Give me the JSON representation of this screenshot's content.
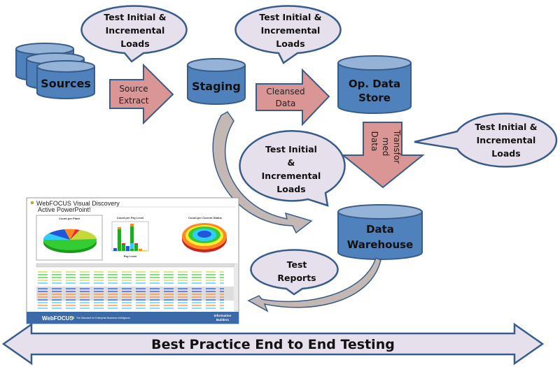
{
  "colors": {
    "cylinder": "#4f81bd",
    "cylinder_top": "#95b3d7",
    "stroke": "#385d8a",
    "arrow": "#d99694",
    "callout": "#e6e0ec",
    "curve": "#c4b8b4"
  },
  "nodes": {
    "sources": "Sources",
    "staging": "Staging",
    "ods": [
      "Op. Data",
      "Store"
    ],
    "dw": [
      "Data",
      "Warehouse"
    ]
  },
  "arrows": {
    "source_extract": [
      "Source",
      "Extract"
    ],
    "cleansed": [
      "Cleansed",
      "Data"
    ],
    "transformed": [
      "Transfor",
      "med",
      "Data"
    ]
  },
  "callouts": {
    "c1": [
      "Test Initial &",
      "Incremental",
      "Loads"
    ],
    "c2": [
      "Test Initial &",
      "Incremental",
      "Loads"
    ],
    "c3": [
      "Test Initial &",
      "Incremental",
      "Loads"
    ],
    "c4": [
      "Test Initial",
      "&",
      "Incremental",
      "Loads"
    ],
    "c5": [
      "Test",
      "Reports"
    ]
  },
  "screenshot": {
    "title": [
      "WebFOCUS Visual Discovery",
      "Active PowerPoint!"
    ],
    "charts": [
      "Count per Plant",
      "Count per Pay Level",
      "Count per Current Status"
    ],
    "xlabel": "Pay Level",
    "footer": "WebFOCUS",
    "tagline": "The Standard for Enterprise Business Intelligence",
    "brand": [
      "Information",
      "Builders"
    ]
  },
  "banner": "Best Practice End to End Testing"
}
